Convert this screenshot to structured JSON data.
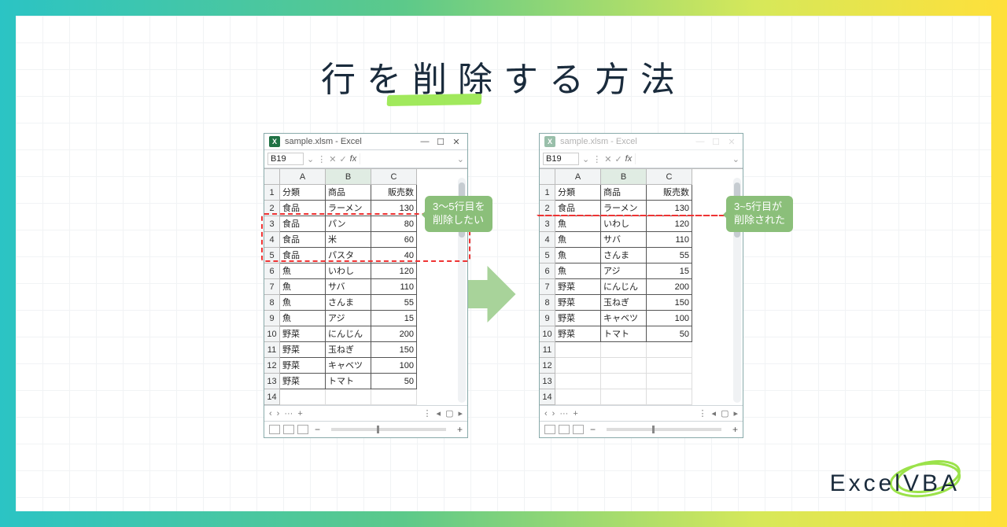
{
  "title": "行を削除する方法",
  "brand": "ExcelVBA",
  "arrow_alt": "arrow-right",
  "callout_left": "3～5行目を\n削除したい",
  "callout_right": "3~5行目が\n削除された",
  "window": {
    "filename": "sample.xlsm - Excel",
    "cellref": "B19",
    "fx_label": "fx",
    "columns": [
      "",
      "A",
      "B",
      "C"
    ],
    "icons": {
      "excel": "X",
      "min": "—",
      "max": "☐",
      "close": "✕"
    },
    "tabs": {
      "prev": "‹",
      "next": "›",
      "more": "···",
      "add": "+",
      "scroll_l": "◂",
      "scroll_c": "▢",
      "scroll_r": "▸"
    },
    "status": {
      "zoom_minus": "−",
      "zoom_plus": "+"
    }
  },
  "headers": [
    "分類",
    "商品",
    "販売数"
  ],
  "left_data": [
    [
      "食品",
      "ラーメン",
      "130"
    ],
    [
      "食品",
      "パン",
      "80"
    ],
    [
      "食品",
      "米",
      "60"
    ],
    [
      "食品",
      "パスタ",
      "40"
    ],
    [
      "魚",
      "いわし",
      "120"
    ],
    [
      "魚",
      "サバ",
      "110"
    ],
    [
      "魚",
      "さんま",
      "55"
    ],
    [
      "魚",
      "アジ",
      "15"
    ],
    [
      "野菜",
      "にんじん",
      "200"
    ],
    [
      "野菜",
      "玉ねぎ",
      "150"
    ],
    [
      "野菜",
      "キャベツ",
      "100"
    ],
    [
      "野菜",
      "トマト",
      "50"
    ]
  ],
  "right_data": [
    [
      "食品",
      "ラーメン",
      "130"
    ],
    [
      "魚",
      "いわし",
      "120"
    ],
    [
      "魚",
      "サバ",
      "110"
    ],
    [
      "魚",
      "さんま",
      "55"
    ],
    [
      "魚",
      "アジ",
      "15"
    ],
    [
      "野菜",
      "にんじん",
      "200"
    ],
    [
      "野菜",
      "玉ねぎ",
      "150"
    ],
    [
      "野菜",
      "キャベツ",
      "100"
    ],
    [
      "野菜",
      "トマト",
      "50"
    ]
  ],
  "highlight": {
    "left_rows": [
      3,
      4,
      5
    ],
    "right_after_row": 2
  }
}
